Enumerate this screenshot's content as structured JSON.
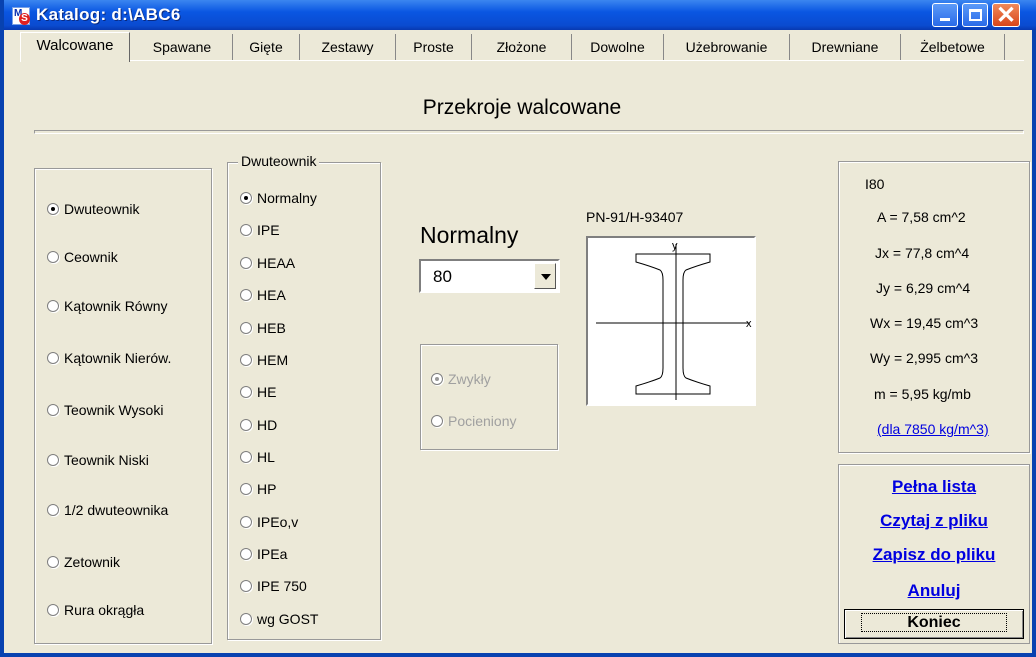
{
  "window": {
    "title": "Katalog: d:\\ABC6"
  },
  "tabs": [
    "Walcowane",
    "Spawane",
    "Gięte",
    "Zestawy",
    "Proste",
    "Złożone",
    "Dowolne",
    "Użebrowanie",
    "Drewniane",
    "Żelbetowe"
  ],
  "active_tab": "Walcowane",
  "heading": "Przekroje walcowane",
  "shape_types": {
    "selected": "Dwuteownik",
    "items": [
      "Dwuteownik",
      "Ceownik",
      "Kątownik Równy",
      "Kątownik Nierów.",
      "Teownik Wysoki",
      "Teownik Niski",
      "1/2 dwuteownika",
      "Zetownik",
      "Rura okrągła"
    ]
  },
  "dwuteownik_group": {
    "title": "Dwuteownik",
    "selected": "Normalny",
    "items": [
      "Normalny",
      "IPE",
      "HEAA",
      "HEA",
      "HEB",
      "HEM",
      "HE",
      "HD",
      "HL",
      "HP",
      "IPEo,v",
      "IPEa",
      "IPE 750",
      "wg GOST"
    ]
  },
  "series_label": "Normalny",
  "size_select": {
    "value": "80"
  },
  "variant": {
    "items": [
      "Zwykły",
      "Pocieniony"
    ],
    "selected": "Zwykły",
    "disabled": true
  },
  "standard": "PN-91/H-93407",
  "figure": {
    "axis_x": "x",
    "axis_y": "y"
  },
  "properties": {
    "name": "I80",
    "A": "A = 7,58 cm^2",
    "Jx": "Jx = 77,8 cm^4",
    "Jy": "Jy = 6,29 cm^4",
    "Wx": "Wx = 19,45 cm^3",
    "Wy": "Wy = 2,995 cm^3",
    "m": "m = 5,95 kg/mb",
    "density_link": "(dla 7850 kg/m^3)"
  },
  "actions": {
    "full_list": "Pełna lista",
    "read_file": "Czytaj z pliku",
    "save_file": "Zapisz do pliku",
    "cancel": "Anuluj",
    "close": "Koniec"
  },
  "colors": {
    "title_bar": "#0a56e2",
    "background": "#ece9d8",
    "link": "#0000e0"
  }
}
